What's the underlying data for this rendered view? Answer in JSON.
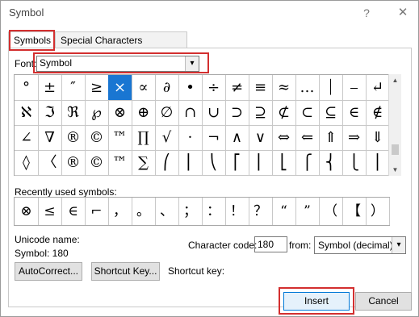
{
  "window": {
    "title": "Symbol",
    "help": "?",
    "close": "✕"
  },
  "tabs": [
    {
      "label": "Symbols"
    },
    {
      "label": "Special Characters"
    }
  ],
  "font": {
    "label": "Font:",
    "value": "Symbol"
  },
  "grid": {
    "selected_index": 4,
    "rows": [
      [
        "°",
        "±",
        "″",
        "≥",
        "×",
        "∝",
        "∂",
        "•",
        "÷",
        "≠",
        "≡",
        "≈",
        "…",
        "⏐",
        "⎯",
        "↵"
      ],
      [
        "ℵ",
        "ℑ",
        "ℜ",
        "℘",
        "⊗",
        "⊕",
        "∅",
        "∩",
        "∪",
        "⊃",
        "⊇",
        "⊄",
        "⊂",
        "⊆",
        "∈",
        "∉"
      ],
      [
        "∠",
        "∇",
        "®",
        "©",
        "™",
        "∏",
        "√",
        "⋅",
        "¬",
        "∧",
        "∨",
        "⇔",
        "⇐",
        "⇑",
        "⇒",
        "⇓"
      ],
      [
        "◊",
        "〈",
        "®",
        "©",
        "™",
        "∑",
        "⎛",
        "⎜",
        "⎝",
        "⎡",
        "⎢",
        "⎣",
        "⎧",
        "⎨",
        "⎩",
        "⎪"
      ]
    ]
  },
  "recent": {
    "label": "Recently used symbols:",
    "items": [
      "⊗",
      "≤",
      "∈",
      "⌐",
      "，",
      "。",
      "、",
      "；",
      "：",
      "！",
      "？",
      "“",
      "”",
      "（",
      "【",
      "）"
    ]
  },
  "unicode": {
    "label": "Unicode name:",
    "value": "Symbol: 180"
  },
  "character_code": {
    "label": "Character code:",
    "value": "180"
  },
  "from": {
    "label": "from:",
    "value": "Symbol (decimal)"
  },
  "buttons": {
    "autocorrect": "AutoCorrect...",
    "shortcut": "Shortcut Key...",
    "insert": "Insert",
    "cancel": "Cancel"
  },
  "shortcut_key_label": "Shortcut key:",
  "icons": {
    "dropdown": "▾",
    "scroll_up": "▲",
    "scroll_down": "▼"
  },
  "colors": {
    "selected": "#1976d2",
    "highlight": "#d32f2f"
  }
}
